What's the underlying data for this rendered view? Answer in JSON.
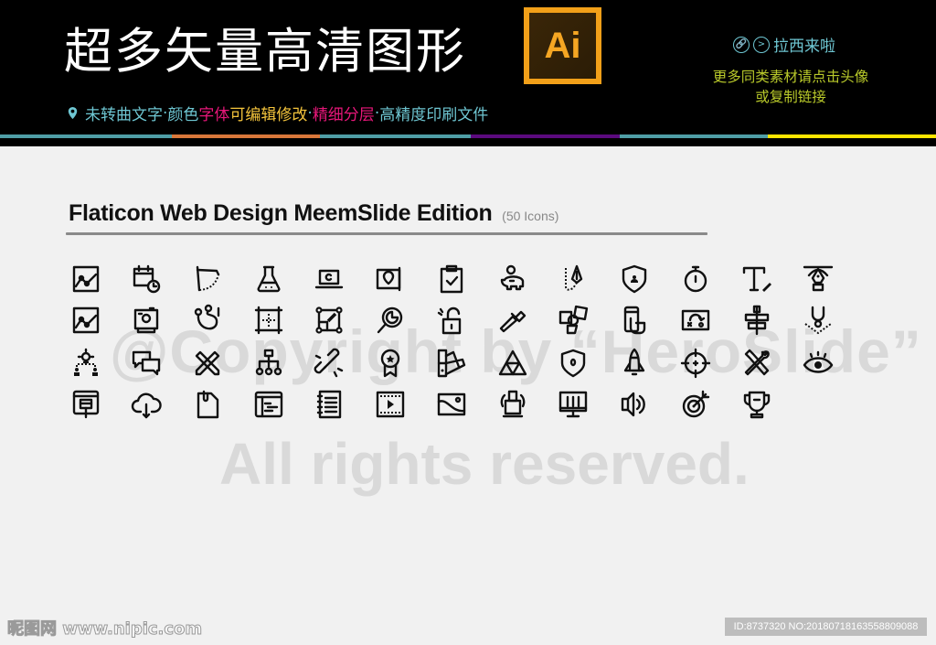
{
  "header": {
    "main_title": "超多矢量高清图形",
    "ai_logo_text": "Ai",
    "features": [
      {
        "text": "未转曲文字",
        "color": "#6ec6d2"
      },
      {
        "text": " · ",
        "color": "#6ec6d2"
      },
      {
        "text": "颜色 ",
        "color": "#6ec6d2"
      },
      {
        "text": "字体",
        "color": "#e8177a"
      },
      {
        "text": "可编辑修改",
        "color": "#f4c43c"
      },
      {
        "text": " · ",
        "color": "#6ec6d2"
      },
      {
        "text": "精细分层",
        "color": "#e8177a"
      },
      {
        "text": " · ",
        "color": "#6ec6d2"
      },
      {
        "text": "高精度印刷文件",
        "color": "#6ec6d2"
      }
    ],
    "author_name": "拉西来啦",
    "more_line1": "更多同类素材请点击头像",
    "more_line2": "或复制链接",
    "colorbar": [
      "#4f9ea6",
      "#d9773a",
      "#4f9ea6",
      "#5b0a7e",
      "#4f9ea6",
      "#ffe600"
    ]
  },
  "section": {
    "title": "Flaticon Web Design MeemSlide Edition",
    "count": "(50 Icons)"
  },
  "icons": [
    "line-chart-icon",
    "calendar-clock-icon",
    "drafting-compass-icon",
    "flask-icon",
    "laptop-icon",
    "map-pin-scroll-icon",
    "clipboard-check-icon",
    "piggy-bank-icon",
    "pen-nib-path-icon",
    "shield-user-icon",
    "stopwatch-icon",
    "text-edit-icon",
    "pen-tool-icon",
    "line-chart-icon",
    "camera-icon",
    "cable-connector-icon",
    "crosshair-frame-icon",
    "transform-edit-icon",
    "magnifier-pie-icon",
    "unlock-icon",
    "color-picker-icon",
    "shapes-icon",
    "touch-phone-icon",
    "strategy-board-icon",
    "align-center-icon",
    "anchor-point-icon",
    "idea-team-icon",
    "chat-bubbles-icon",
    "pencil-ruler-icon",
    "sitemap-icon",
    "broken-link-icon",
    "award-ribbon-icon",
    "color-swatch-icon",
    "triangles-icon",
    "shield-badge-icon",
    "rocket-icon",
    "target-crosshair-icon",
    "tools-icon",
    "eye-icon",
    "web-paint-icon",
    "cloud-download-icon",
    "file-clip-icon",
    "browser-code-icon",
    "notebook-list-icon",
    "video-frame-icon",
    "image-icon",
    "printer-sync-icon",
    "monitor-equalizer-icon",
    "speaker-icon",
    "target-arrow-icon",
    "trophy-icon"
  ],
  "watermarks": {
    "line1": "@Copyright by “HeroSlide”",
    "line2": "All rights reserved."
  },
  "footer": {
    "site_watermark": "昵图网 www.nipic.com",
    "id_label": "ID:8737320 NO:20180718163558809088"
  }
}
